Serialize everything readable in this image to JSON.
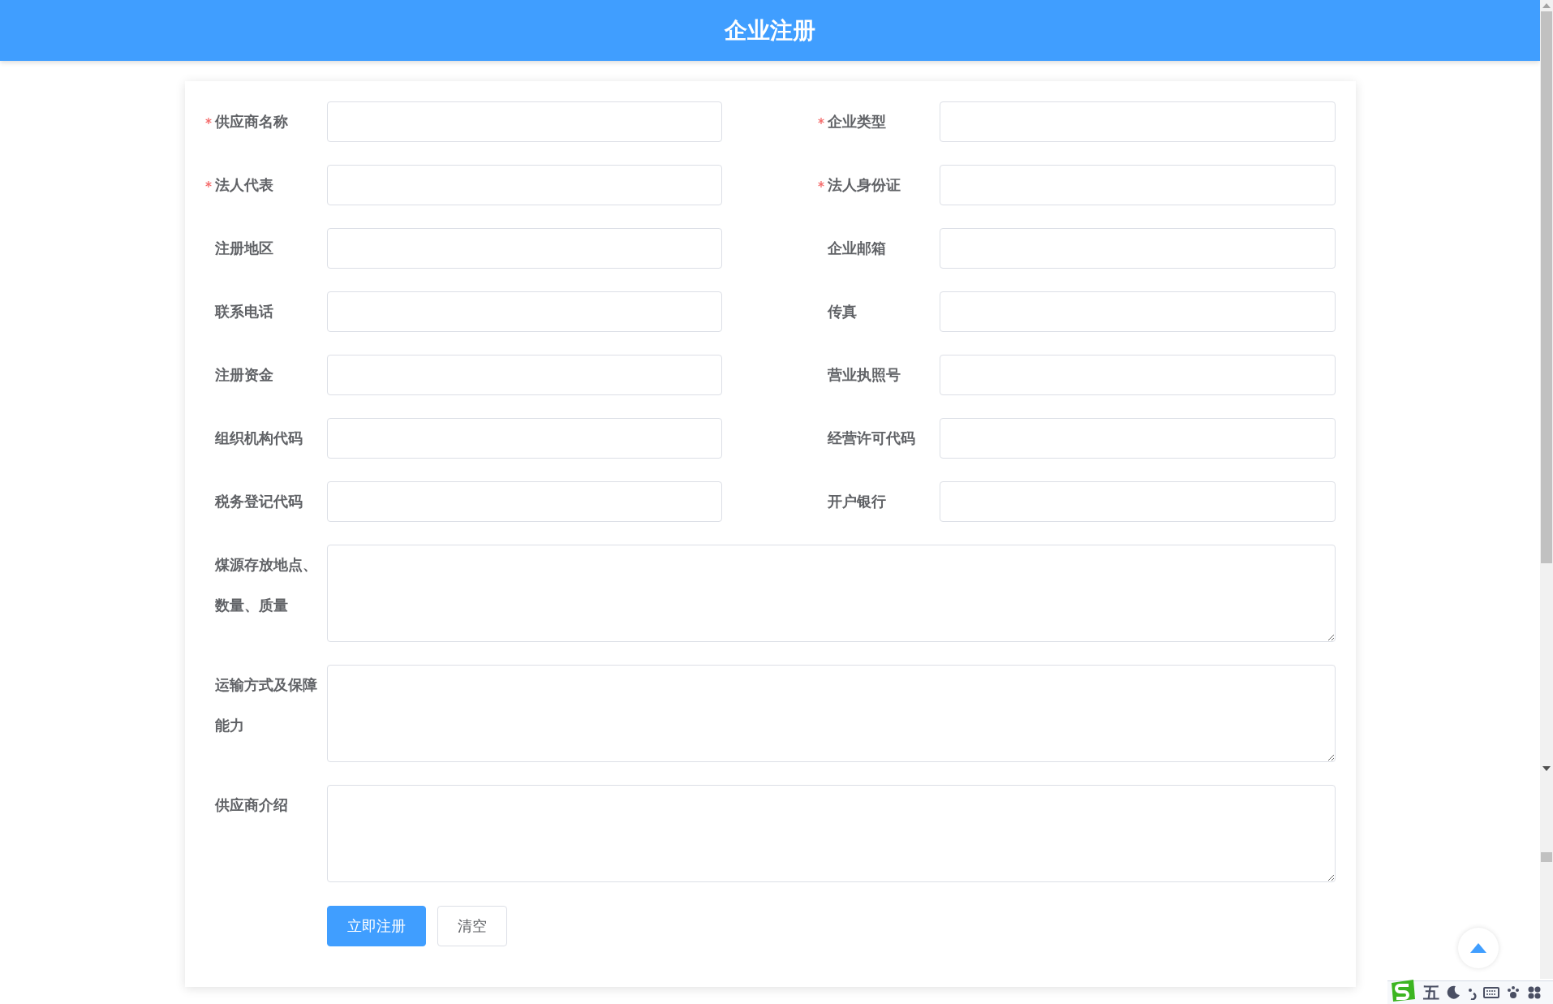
{
  "header": {
    "title": "企业注册"
  },
  "fields": [
    {
      "label": "供应商名称",
      "required": true,
      "kind": "input"
    },
    {
      "label": "企业类型",
      "required": true,
      "kind": "input"
    },
    {
      "label": "法人代表",
      "required": true,
      "kind": "input"
    },
    {
      "label": "法人身份证",
      "required": true,
      "kind": "input"
    },
    {
      "label": "注册地区",
      "required": false,
      "kind": "input"
    },
    {
      "label": "企业邮箱",
      "required": false,
      "kind": "input"
    },
    {
      "label": "联系电话",
      "required": false,
      "kind": "input"
    },
    {
      "label": "传真",
      "required": false,
      "kind": "input"
    },
    {
      "label": "注册资金",
      "required": false,
      "kind": "input"
    },
    {
      "label": "营业执照号",
      "required": false,
      "kind": "input"
    },
    {
      "label": "组织机构代码",
      "required": false,
      "kind": "input"
    },
    {
      "label": "经营许可代码",
      "required": false,
      "kind": "input"
    },
    {
      "label": "税务登记代码",
      "required": false,
      "kind": "input"
    },
    {
      "label": "开户银行",
      "required": false,
      "kind": "input"
    },
    {
      "label": "煤源存放地点、数量、质量",
      "required": false,
      "kind": "textarea"
    },
    {
      "label": "运输方式及保障能力",
      "required": false,
      "kind": "textarea"
    },
    {
      "label": "供应商介绍",
      "required": false,
      "kind": "textarea"
    }
  ],
  "buttons": [
    {
      "label": "立即注册",
      "kind": "primary"
    },
    {
      "label": "清空",
      "kind": "default"
    }
  ],
  "ime_toolbar": {
    "mode": "五"
  }
}
